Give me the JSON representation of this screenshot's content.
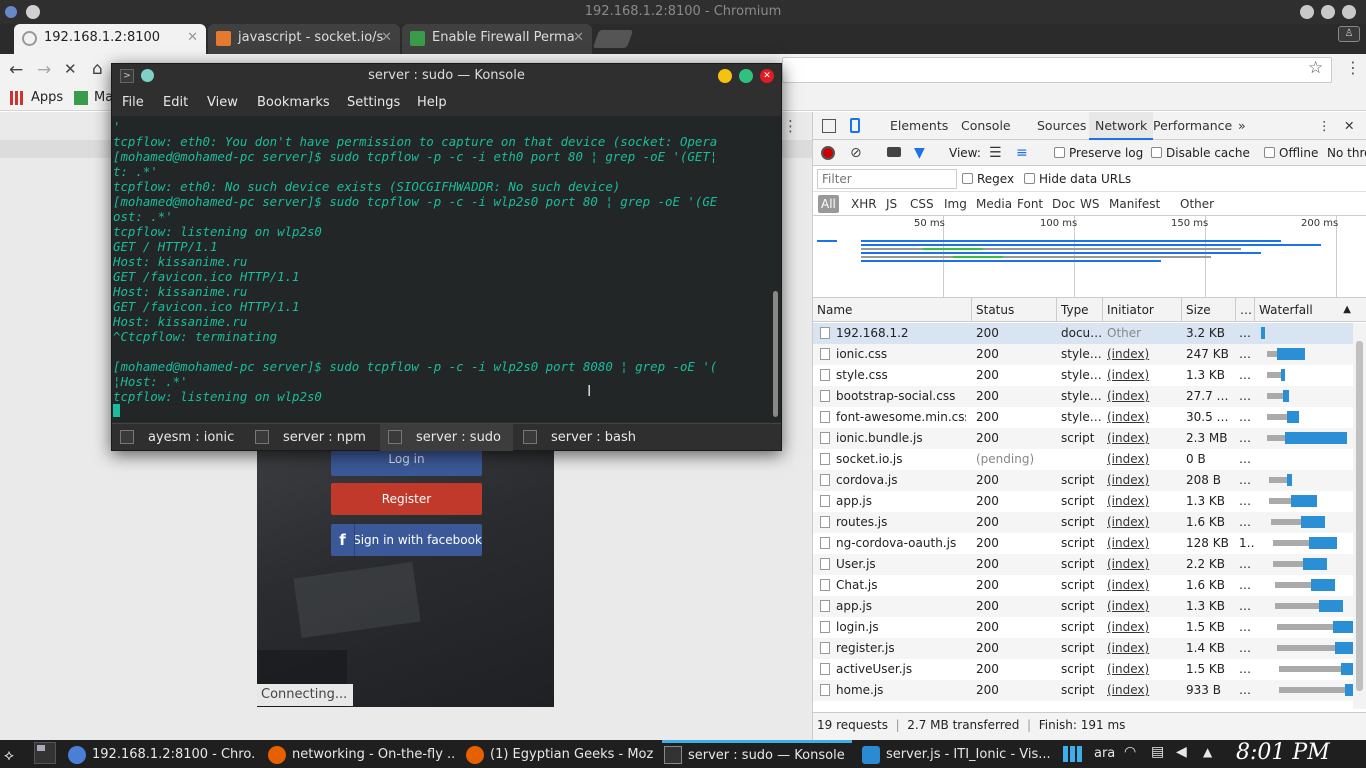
{
  "window": {
    "title": "192.168.1.2:8100 - Chromium"
  },
  "tabs": [
    {
      "label": "192.168.1.2:8100",
      "active": true
    },
    {
      "label": "javascript - socket.io/s"
    },
    {
      "label": "Enable Firewall Perma"
    }
  ],
  "bookmarks": {
    "apps": "Apps",
    "ma": "Ma"
  },
  "page": {
    "login": "Log in",
    "register": "Register",
    "facebook": "Sign in with facebook",
    "status": "Connecting..."
  },
  "konsole": {
    "title": "server : sudo — Konsole",
    "menu": [
      "File",
      "Edit",
      "View",
      "Bookmarks",
      "Settings",
      "Help"
    ],
    "lines": [
      "'",
      "tcpflow: eth0: You don't have permission to capture on that device (socket: Opera",
      "[mohamed@mohamed-pc server]$ sudo tcpflow -p -c -i eth0 port 80 ¦ grep -oE '(GET¦",
      "t: .*'",
      "tcpflow: eth0: No such device exists (SIOCGIFHWADDR: No such device)",
      "[mohamed@mohamed-pc server]$ sudo tcpflow -p -c -i wlp2s0 port 80 ¦ grep -oE '(GE",
      "ost: .*'",
      "tcpflow: listening on wlp2s0",
      "GET / HTTP/1.1",
      "Host: kissanime.ru",
      "GET /favicon.ico HTTP/1.1",
      "Host: kissanime.ru",
      "GET /favicon.ico HTTP/1.1",
      "Host: kissanime.ru",
      "^Ctcpflow: terminating",
      "",
      "[mohamed@mohamed-pc server]$ sudo tcpflow -p -c -i wlp2s0 port 8080 ¦ grep -oE '(",
      "¦Host: .*'",
      "tcpflow: listening on wlp2s0"
    ],
    "tabs": [
      "ayesm : ionic",
      "server : npm",
      "server : sudo",
      "server : bash"
    ]
  },
  "devtools": {
    "tabs": [
      "Elements",
      "Console",
      "Sources",
      "Network",
      "Performance"
    ],
    "view_label": "View:",
    "preserve_log": "Preserve log",
    "disable_cache": "Disable cache",
    "offline": "Offline",
    "throttle": "No thro",
    "filter_placeholder": "Filter",
    "regex": "Regex",
    "hide_data_urls": "Hide data URLs",
    "types": [
      "All",
      "XHR",
      "JS",
      "CSS",
      "Img",
      "Media",
      "Font",
      "Doc",
      "WS",
      "Manifest",
      "Other"
    ],
    "timeline_ticks": [
      "50 ms",
      "100 ms",
      "150 ms",
      "200 ms"
    ],
    "columns": [
      "Name",
      "Status",
      "Type",
      "Initiator",
      "Size",
      "…",
      "Waterfall"
    ],
    "rows": [
      {
        "name": "192.168.1.2",
        "status": "200",
        "type": "docu…",
        "initiator": "Other",
        "size": "3.2 KB",
        "time": "…"
      },
      {
        "name": "ionic.css",
        "status": "200",
        "type": "style…",
        "initiator": "(index)",
        "size": "247 KB",
        "time": "…"
      },
      {
        "name": "style.css",
        "status": "200",
        "type": "style…",
        "initiator": "(index)",
        "size": "1.3 KB",
        "time": "…"
      },
      {
        "name": "bootstrap-social.css",
        "status": "200",
        "type": "style…",
        "initiator": "(index)",
        "size": "27.7 …",
        "time": "…"
      },
      {
        "name": "font-awesome.min.css",
        "status": "200",
        "type": "style…",
        "initiator": "(index)",
        "size": "30.5 …",
        "time": "…"
      },
      {
        "name": "ionic.bundle.js",
        "status": "200",
        "type": "script",
        "initiator": "(index)",
        "size": "2.3 MB",
        "time": "…"
      },
      {
        "name": "socket.io.js",
        "status": "(pending)",
        "type": "",
        "initiator": "(index)",
        "size": "0 B",
        "time": "…"
      },
      {
        "name": "cordova.js",
        "status": "200",
        "type": "script",
        "initiator": "(index)",
        "size": "208 B",
        "time": "…"
      },
      {
        "name": "app.js",
        "status": "200",
        "type": "script",
        "initiator": "(index)",
        "size": "1.3 KB",
        "time": "…"
      },
      {
        "name": "routes.js",
        "status": "200",
        "type": "script",
        "initiator": "(index)",
        "size": "1.6 KB",
        "time": "…"
      },
      {
        "name": "ng-cordova-oauth.js",
        "status": "200",
        "type": "script",
        "initiator": "(index)",
        "size": "128 KB",
        "time": "1…"
      },
      {
        "name": "User.js",
        "status": "200",
        "type": "script",
        "initiator": "(index)",
        "size": "2.2 KB",
        "time": "…"
      },
      {
        "name": "Chat.js",
        "status": "200",
        "type": "script",
        "initiator": "(index)",
        "size": "1.6 KB",
        "time": "…"
      },
      {
        "name": "app.js",
        "status": "200",
        "type": "script",
        "initiator": "(index)",
        "size": "1.3 KB",
        "time": "…"
      },
      {
        "name": "login.js",
        "status": "200",
        "type": "script",
        "initiator": "(index)",
        "size": "1.5 KB",
        "time": "…"
      },
      {
        "name": "register.js",
        "status": "200",
        "type": "script",
        "initiator": "(index)",
        "size": "1.4 KB",
        "time": "…"
      },
      {
        "name": "activeUser.js",
        "status": "200",
        "type": "script",
        "initiator": "(index)",
        "size": "1.5 KB",
        "time": "…"
      },
      {
        "name": "home.js",
        "status": "200",
        "type": "script",
        "initiator": "(index)",
        "size": "933 B",
        "time": "…"
      }
    ],
    "status_bar": {
      "requests": "19 requests",
      "transferred": "2.7 MB transferred",
      "finish": "Finish: 191 ms"
    }
  },
  "taskbar": {
    "items": [
      "192.168.1.2:8100 - Chro...",
      "networking - On-the-fly ...",
      "(1) Egyptian Geeks - Moz...",
      "server : sudo — Konsole",
      "server.js - ITI_Ionic - Vis..."
    ],
    "lang": "ara",
    "clock": "8:01 PM"
  }
}
